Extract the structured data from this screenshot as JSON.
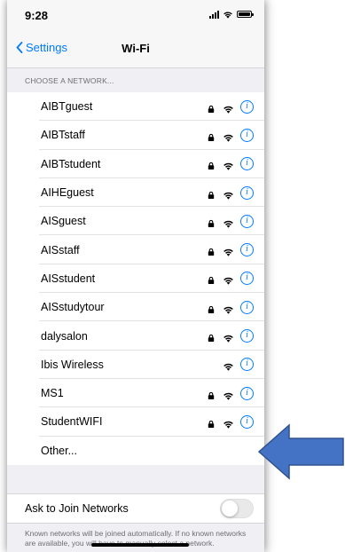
{
  "status_bar": {
    "time": "9:28"
  },
  "nav": {
    "back_label": "Settings",
    "title": "Wi-Fi"
  },
  "section_header": "CHOOSE A NETWORK...",
  "networks": [
    {
      "name": "AIBTguest",
      "secured": true
    },
    {
      "name": "AIBTstaff",
      "secured": true
    },
    {
      "name": "AIBTstudent",
      "secured": true
    },
    {
      "name": "AIHEguest",
      "secured": true
    },
    {
      "name": "AISguest",
      "secured": true
    },
    {
      "name": "AISstaff",
      "secured": true
    },
    {
      "name": "AISstudent",
      "secured": true
    },
    {
      "name": "AISstudytour",
      "secured": true
    },
    {
      "name": "dalysalon",
      "secured": true
    },
    {
      "name": "Ibis Wireless",
      "secured": false
    },
    {
      "name": "MS1",
      "secured": true
    },
    {
      "name": "StudentWIFI",
      "secured": true
    }
  ],
  "other_label": "Other...",
  "ask_to_join": {
    "label": "Ask to Join Networks",
    "enabled": false
  },
  "footer_note": "Known networks will be joined automatically. If no known networks are available, you will have to manually select a network.",
  "colors": {
    "accent": "#007aff",
    "annotation_arrow": "#4472c4"
  }
}
